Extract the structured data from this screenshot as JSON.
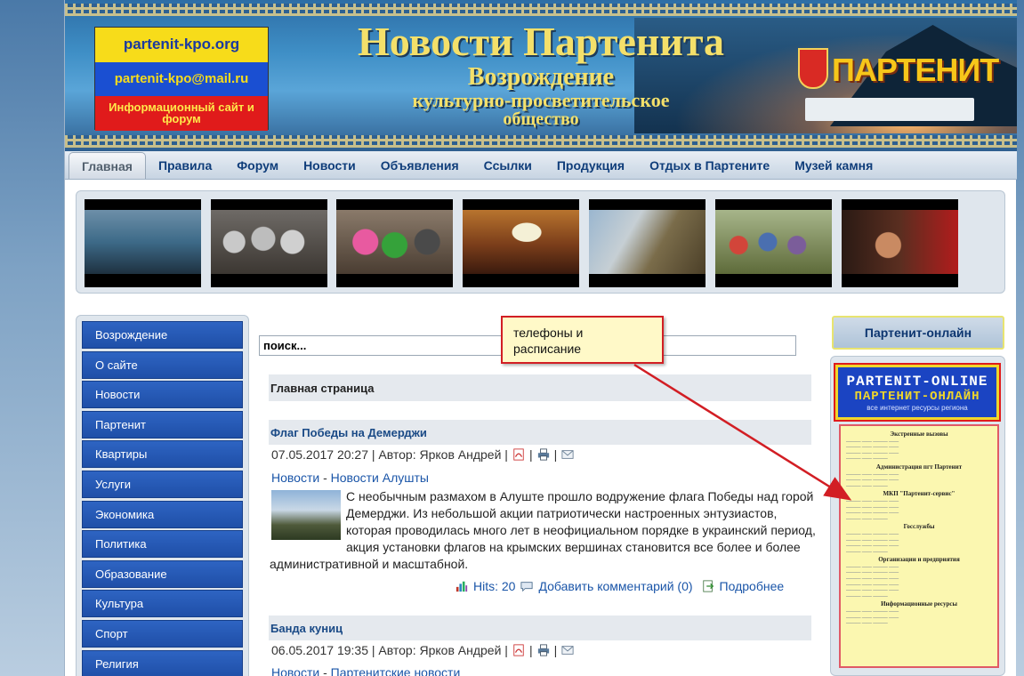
{
  "header": {
    "flag_line1": "partenit-kpo.org",
    "flag_line2": "partenit-kpo@mail.ru",
    "flag_line3": "Информационный сайт и форум",
    "title": "Новости Партенита",
    "subtitle1": "Возрождение",
    "subtitle2": "культурно-просветительское",
    "subtitle3": "общество",
    "brand": "ПАРТЕНИТ"
  },
  "nav": {
    "items": [
      {
        "label": "Главная"
      },
      {
        "label": "Правила"
      },
      {
        "label": "Форум"
      },
      {
        "label": "Новости"
      },
      {
        "label": "Объявления"
      },
      {
        "label": "Ссылки"
      },
      {
        "label": "Продукция"
      },
      {
        "label": "Отдых в Партените"
      },
      {
        "label": "Музей камня"
      }
    ]
  },
  "sidebar": {
    "items": [
      {
        "label": "Возрождение"
      },
      {
        "label": "О сайте"
      },
      {
        "label": "Новости"
      },
      {
        "label": "Партенит"
      },
      {
        "label": "Квартиры"
      },
      {
        "label": "Услуги"
      },
      {
        "label": "Экономика"
      },
      {
        "label": "Политика"
      },
      {
        "label": "Образование"
      },
      {
        "label": "Культура"
      },
      {
        "label": "Спорт"
      },
      {
        "label": "Религия"
      }
    ]
  },
  "search": {
    "value": "поиск..."
  },
  "main": {
    "page_heading": "Главная страница",
    "articles": [
      {
        "title": "Флаг Победы на Демерджи",
        "meta": "07.05.2017 20:27 | Автор: Ярков Андрей |",
        "cat1": "Новости",
        "cat_sep": " - ",
        "cat2": "Новости Алушты",
        "text": "С необычным размахом в Алуште прошло водружение флага Победы над горой Демерджи. Из небольшой акции патриотически настроенных энтузиастов, которая проводилась много лет в неофициальном порядке в украинский период, акция установки флагов на крымских вершинах становится все более и более административной и масштабной.",
        "hits": "Hits: 20",
        "comment": "Добавить комментарий (0)",
        "more": "Подробнее"
      },
      {
        "title": "Банда куниц",
        "meta": "06.05.2017 19:35 | Автор: Ярков Андрей |",
        "cat1": "Новости",
        "cat_sep": " - ",
        "cat2": "Партенитские новости"
      }
    ]
  },
  "right": {
    "title": "Партенит-онлайн",
    "banner_line1": "PARTENIT-ONLINE",
    "banner_line2": "ПАРТЕНИТ-ОНЛАЙН",
    "banner_line3": "все интернет ресурсы региона",
    "phones_head1": "Экстренные вызовы",
    "phones_head2": "Администрация пгт Партенит",
    "phones_head3": "МКП \"Партенит-сервис\"",
    "phones_head4": "Госслужбы",
    "phones_head5": "Организации и предприятия",
    "phones_head6": "Информационные ресурсы"
  },
  "callout": {
    "text": "телефоны и расписание"
  },
  "colors": {
    "nav_link": "#0f3d7a",
    "sidebar_item": "#2e64c2",
    "link": "#1a55a8",
    "callout_border": "#d21e24"
  }
}
